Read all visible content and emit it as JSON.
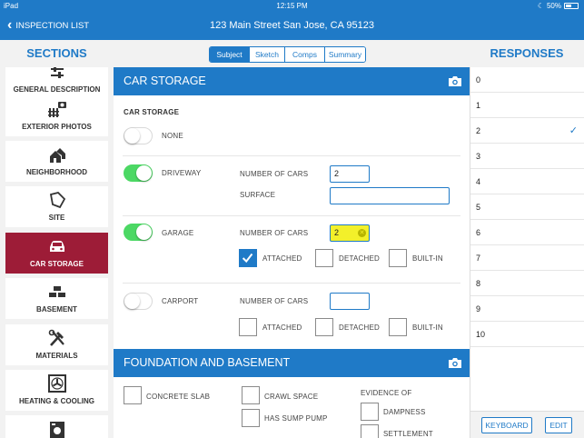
{
  "status_bar": {
    "device": "iPad",
    "time": "12:15 PM",
    "battery": "50%",
    "battery_level": 0.5
  },
  "nav": {
    "back_label": "INSPECTION LIST",
    "title": "123 Main Street San Jose, CA 95123"
  },
  "sections_title": "SECTIONS",
  "responses_title": "RESPONSES",
  "tabs": [
    {
      "label": "Subject",
      "active": true
    },
    {
      "label": "Sketch",
      "active": false
    },
    {
      "label": "Comps",
      "active": false
    },
    {
      "label": "Summary",
      "active": false
    }
  ],
  "sidebar": {
    "items": [
      {
        "label": "GENERAL DESCRIPTION",
        "icon": "sliders-icon"
      },
      {
        "label": "EXTERIOR PHOTOS",
        "icon": "fence-camera-icon"
      },
      {
        "label": "NEIGHBORHOOD",
        "icon": "houses-icon"
      },
      {
        "label": "SITE",
        "icon": "lot-outline-icon"
      },
      {
        "label": "CAR STORAGE",
        "icon": "car-icon",
        "active": true
      },
      {
        "label": "BASEMENT",
        "icon": "bricks-icon"
      },
      {
        "label": "MATERIALS",
        "icon": "tools-icon"
      },
      {
        "label": "HEATING & COOLING",
        "icon": "fan-icon"
      },
      {
        "label": "",
        "icon": "washer-icon"
      }
    ]
  },
  "car_storage": {
    "header": "CAR STORAGE",
    "section_label": "CAR STORAGE",
    "none": {
      "label": "NONE",
      "on": false
    },
    "driveway": {
      "label": "DRIVEWAY",
      "on": true,
      "cars_label": "NUMBER OF CARS",
      "cars_value": "2",
      "surface_label": "SURFACE",
      "surface_value": ""
    },
    "garage": {
      "label": "GARAGE",
      "on": true,
      "cars_label": "NUMBER OF CARS",
      "cars_value": "2",
      "attached_label": "ATTACHED",
      "attached": true,
      "detached_label": "DETACHED",
      "detached": false,
      "builtin_label": "BUILT-IN",
      "builtin": false
    },
    "carport": {
      "label": "CARPORT",
      "on": false,
      "cars_label": "NUMBER OF CARS",
      "cars_value": "",
      "attached_label": "ATTACHED",
      "attached": false,
      "detached_label": "DETACHED",
      "detached": false,
      "builtin_label": "BUILT-IN",
      "builtin": false
    }
  },
  "foundation": {
    "header": "FOUNDATION AND BASEMENT",
    "concrete_slab": "CONCRETE SLAB",
    "crawl_space": "CRAWL SPACE",
    "sump_pump": "HAS SUMP PUMP",
    "evidence_of": "EVIDENCE OF",
    "dampness": "DAMPNESS",
    "settlement": "SETTLEMENT"
  },
  "responses": {
    "items": [
      "0",
      "1",
      "2",
      "3",
      "4",
      "5",
      "6",
      "7",
      "8",
      "9",
      "10"
    ],
    "selected": "2",
    "keyboard_label": "KEYBOARD",
    "edit_label": "EDIT"
  },
  "colors": {
    "primary": "#1f7ac7",
    "active_section": "#9d1c37",
    "toggle_on": "#4cd864",
    "highlight": "#f3f02a"
  }
}
